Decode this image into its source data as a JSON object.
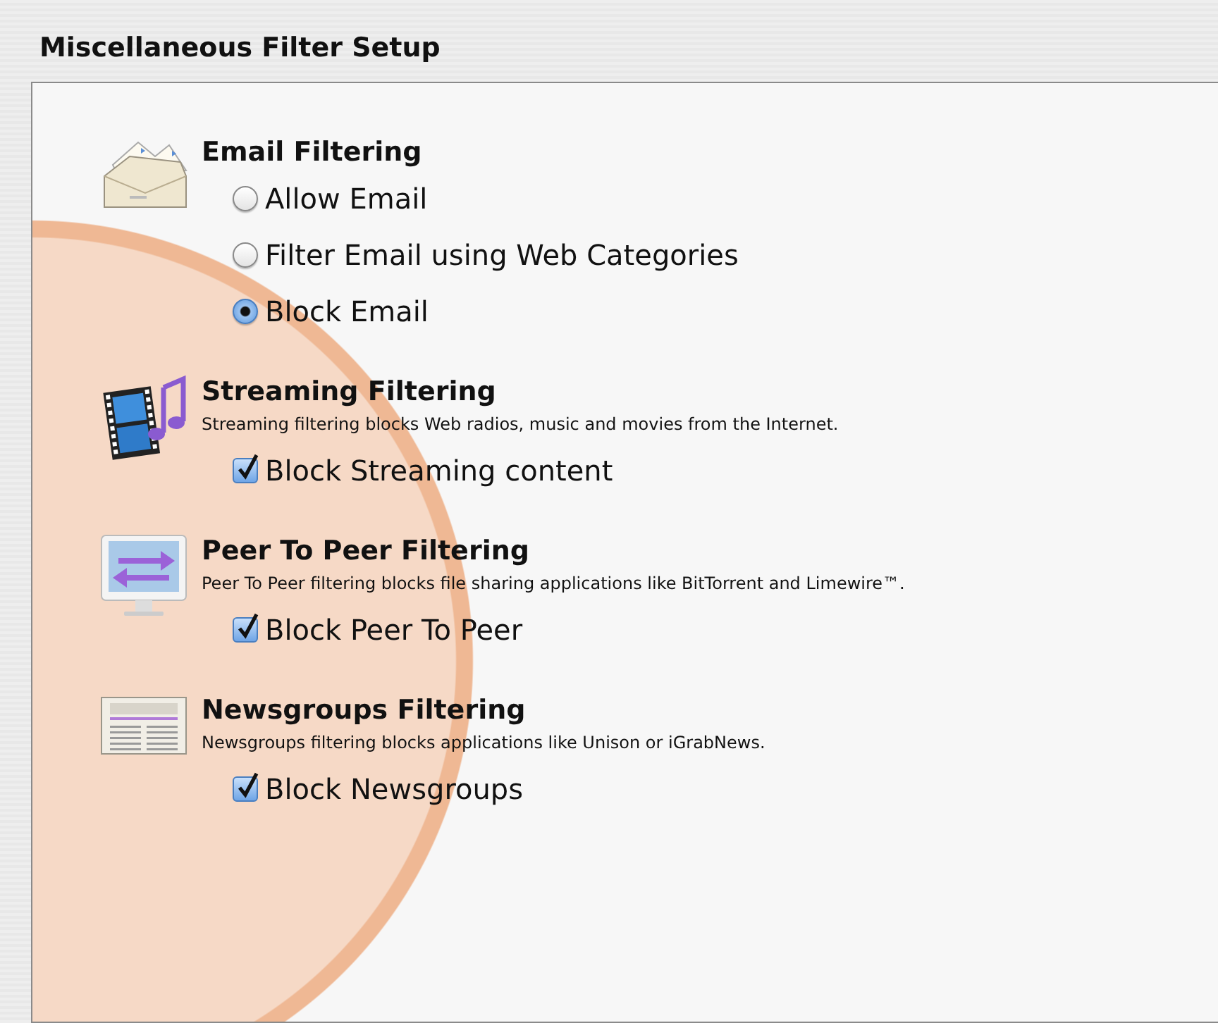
{
  "title": "Miscellaneous Filter Setup",
  "sections": [
    {
      "kind": "radio",
      "heading": "Email Filtering",
      "options": [
        {
          "label": "Allow Email",
          "selected": false
        },
        {
          "label": "Filter Email using Web Categories",
          "selected": false
        },
        {
          "label": "Block Email",
          "selected": true
        }
      ]
    },
    {
      "kind": "checkbox",
      "heading": "Streaming Filtering",
      "description": "Streaming filtering blocks Web radios, music and movies from the Internet.",
      "options": [
        {
          "label": "Block Streaming content",
          "checked": true
        }
      ]
    },
    {
      "kind": "checkbox",
      "heading": "Peer To Peer Filtering",
      "description": "Peer To Peer filtering blocks file sharing applications like BitTorrent and Limewire™.",
      "options": [
        {
          "label": "Block Peer To Peer",
          "checked": true
        }
      ]
    },
    {
      "kind": "checkbox",
      "heading": "Newsgroups Filtering",
      "description": "Newsgroups filtering blocks applications like Unison or iGrabNews.",
      "options": [
        {
          "label": "Block Newsgroups",
          "checked": true
        }
      ]
    }
  ]
}
